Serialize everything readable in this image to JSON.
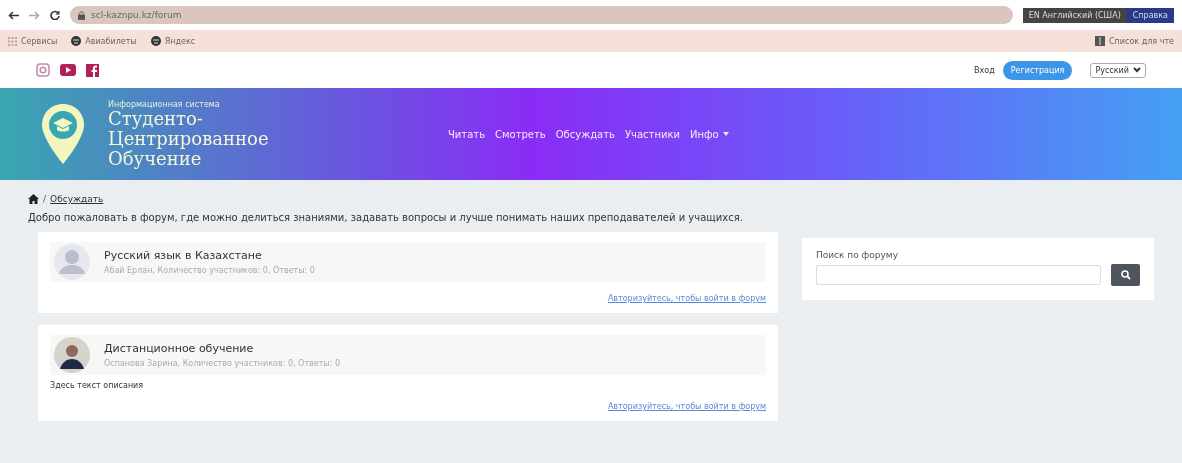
{
  "browser": {
    "url": "scl-kaznpu.kz/forum",
    "ime": "EN Английский (США)",
    "help": "Справка",
    "bookmarks": [
      {
        "label": "Сервисы",
        "kind": "apps"
      },
      {
        "label": "Авиабилеты",
        "kind": "site"
      },
      {
        "label": "Яндекс",
        "kind": "site"
      }
    ],
    "reading_list": "Список для чте"
  },
  "topbar": {
    "login": "Вход",
    "register": "Регистрация",
    "language": "Русский"
  },
  "header": {
    "subtitle": "Информационная система",
    "title_lines": [
      "Студенто-",
      "Центрированное",
      "Обучение"
    ],
    "nav": [
      {
        "label": "Читать",
        "dropdown": false
      },
      {
        "label": "Смотреть",
        "dropdown": false
      },
      {
        "label": "Обсуждать",
        "dropdown": false
      },
      {
        "label": "Участники",
        "dropdown": false
      },
      {
        "label": "Инфо",
        "dropdown": true
      }
    ]
  },
  "breadcrumb": {
    "separator": "/",
    "current": "Обсуждать"
  },
  "intro": "Добро пожаловать в форум, где можно делиться знаниями, задавать вопросы и лучше понимать наших преподавателей и учащихся.",
  "topics": [
    {
      "title": "Русский язык в Казахстане",
      "meta": "Абай Ерлан, Количество участников: 0, Ответы: 0",
      "kind": "default",
      "login_link": "Авторизуйтесь, чтобы войти в форум"
    },
    {
      "title": "Дистанционное обучение",
      "meta": "Оспанова Зарина, Количество участников: 0, Ответы: 0",
      "kind": "photo",
      "description": "Здесь текст описания",
      "login_link": "Авторизуйтесь, чтобы войти в форум"
    }
  ],
  "search": {
    "label": "Поиск по форуму"
  }
}
